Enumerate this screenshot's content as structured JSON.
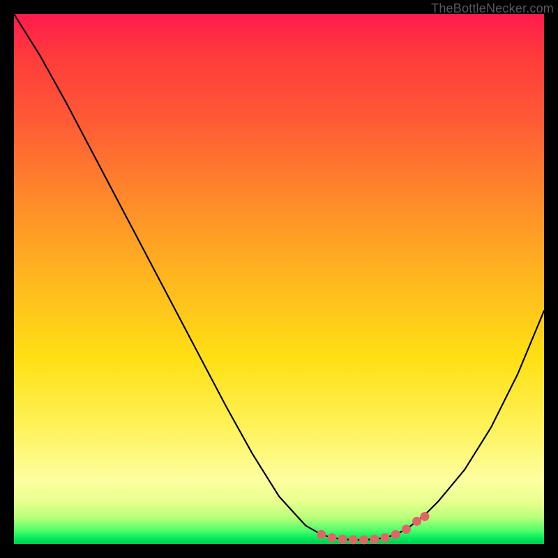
{
  "watermark": "TheBottleNecker.com",
  "colors": {
    "frame": "#000000",
    "curve": "#000000",
    "marker_fill": "#e06666",
    "marker_stroke": "#c84f4f"
  },
  "chart_data": {
    "type": "line",
    "title": "",
    "xlabel": "",
    "ylabel": "",
    "xlim": [
      0,
      100
    ],
    "ylim": [
      0,
      100
    ],
    "x": [
      0,
      5,
      10,
      15,
      20,
      25,
      30,
      35,
      40,
      45,
      50,
      55,
      58,
      60,
      62,
      64,
      66,
      68,
      70,
      72,
      74,
      76,
      78,
      80,
      85,
      90,
      95,
      100
    ],
    "values": [
      100,
      92,
      83,
      73.5,
      64,
      54.5,
      45,
      35.5,
      26,
      17,
      9,
      3.5,
      1.8,
      1.2,
      0.9,
      0.8,
      0.8,
      0.9,
      1.2,
      1.8,
      2.8,
      4.3,
      6,
      8,
      14,
      22,
      32,
      44
    ],
    "markers": {
      "x": [
        58,
        60,
        62,
        64,
        66,
        68,
        70,
        72,
        74,
        76,
        77.5
      ],
      "y": [
        1.8,
        1.2,
        0.9,
        0.8,
        0.8,
        0.9,
        1.2,
        1.8,
        2.8,
        4.3,
        5.2
      ]
    },
    "legend": null,
    "grid": false
  }
}
